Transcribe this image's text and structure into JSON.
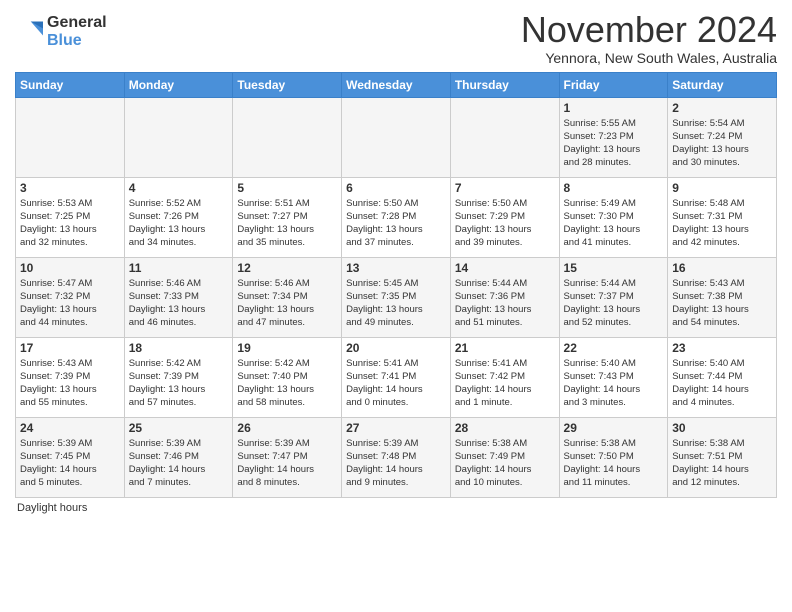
{
  "header": {
    "logo_line1": "General",
    "logo_line2": "Blue",
    "month_title": "November 2024",
    "subtitle": "Yennora, New South Wales, Australia"
  },
  "days_of_week": [
    "Sunday",
    "Monday",
    "Tuesday",
    "Wednesday",
    "Thursday",
    "Friday",
    "Saturday"
  ],
  "weeks": [
    [
      {
        "day": "",
        "info": ""
      },
      {
        "day": "",
        "info": ""
      },
      {
        "day": "",
        "info": ""
      },
      {
        "day": "",
        "info": ""
      },
      {
        "day": "",
        "info": ""
      },
      {
        "day": "1",
        "info": "Sunrise: 5:55 AM\nSunset: 7:23 PM\nDaylight: 13 hours\nand 28 minutes."
      },
      {
        "day": "2",
        "info": "Sunrise: 5:54 AM\nSunset: 7:24 PM\nDaylight: 13 hours\nand 30 minutes."
      }
    ],
    [
      {
        "day": "3",
        "info": "Sunrise: 5:53 AM\nSunset: 7:25 PM\nDaylight: 13 hours\nand 32 minutes."
      },
      {
        "day": "4",
        "info": "Sunrise: 5:52 AM\nSunset: 7:26 PM\nDaylight: 13 hours\nand 34 minutes."
      },
      {
        "day": "5",
        "info": "Sunrise: 5:51 AM\nSunset: 7:27 PM\nDaylight: 13 hours\nand 35 minutes."
      },
      {
        "day": "6",
        "info": "Sunrise: 5:50 AM\nSunset: 7:28 PM\nDaylight: 13 hours\nand 37 minutes."
      },
      {
        "day": "7",
        "info": "Sunrise: 5:50 AM\nSunset: 7:29 PM\nDaylight: 13 hours\nand 39 minutes."
      },
      {
        "day": "8",
        "info": "Sunrise: 5:49 AM\nSunset: 7:30 PM\nDaylight: 13 hours\nand 41 minutes."
      },
      {
        "day": "9",
        "info": "Sunrise: 5:48 AM\nSunset: 7:31 PM\nDaylight: 13 hours\nand 42 minutes."
      }
    ],
    [
      {
        "day": "10",
        "info": "Sunrise: 5:47 AM\nSunset: 7:32 PM\nDaylight: 13 hours\nand 44 minutes."
      },
      {
        "day": "11",
        "info": "Sunrise: 5:46 AM\nSunset: 7:33 PM\nDaylight: 13 hours\nand 46 minutes."
      },
      {
        "day": "12",
        "info": "Sunrise: 5:46 AM\nSunset: 7:34 PM\nDaylight: 13 hours\nand 47 minutes."
      },
      {
        "day": "13",
        "info": "Sunrise: 5:45 AM\nSunset: 7:35 PM\nDaylight: 13 hours\nand 49 minutes."
      },
      {
        "day": "14",
        "info": "Sunrise: 5:44 AM\nSunset: 7:36 PM\nDaylight: 13 hours\nand 51 minutes."
      },
      {
        "day": "15",
        "info": "Sunrise: 5:44 AM\nSunset: 7:37 PM\nDaylight: 13 hours\nand 52 minutes."
      },
      {
        "day": "16",
        "info": "Sunrise: 5:43 AM\nSunset: 7:38 PM\nDaylight: 13 hours\nand 54 minutes."
      }
    ],
    [
      {
        "day": "17",
        "info": "Sunrise: 5:43 AM\nSunset: 7:39 PM\nDaylight: 13 hours\nand 55 minutes."
      },
      {
        "day": "18",
        "info": "Sunrise: 5:42 AM\nSunset: 7:39 PM\nDaylight: 13 hours\nand 57 minutes."
      },
      {
        "day": "19",
        "info": "Sunrise: 5:42 AM\nSunset: 7:40 PM\nDaylight: 13 hours\nand 58 minutes."
      },
      {
        "day": "20",
        "info": "Sunrise: 5:41 AM\nSunset: 7:41 PM\nDaylight: 14 hours\nand 0 minutes."
      },
      {
        "day": "21",
        "info": "Sunrise: 5:41 AM\nSunset: 7:42 PM\nDaylight: 14 hours\nand 1 minute."
      },
      {
        "day": "22",
        "info": "Sunrise: 5:40 AM\nSunset: 7:43 PM\nDaylight: 14 hours\nand 3 minutes."
      },
      {
        "day": "23",
        "info": "Sunrise: 5:40 AM\nSunset: 7:44 PM\nDaylight: 14 hours\nand 4 minutes."
      }
    ],
    [
      {
        "day": "24",
        "info": "Sunrise: 5:39 AM\nSunset: 7:45 PM\nDaylight: 14 hours\nand 5 minutes."
      },
      {
        "day": "25",
        "info": "Sunrise: 5:39 AM\nSunset: 7:46 PM\nDaylight: 14 hours\nand 7 minutes."
      },
      {
        "day": "26",
        "info": "Sunrise: 5:39 AM\nSunset: 7:47 PM\nDaylight: 14 hours\nand 8 minutes."
      },
      {
        "day": "27",
        "info": "Sunrise: 5:39 AM\nSunset: 7:48 PM\nDaylight: 14 hours\nand 9 minutes."
      },
      {
        "day": "28",
        "info": "Sunrise: 5:38 AM\nSunset: 7:49 PM\nDaylight: 14 hours\nand 10 minutes."
      },
      {
        "day": "29",
        "info": "Sunrise: 5:38 AM\nSunset: 7:50 PM\nDaylight: 14 hours\nand 11 minutes."
      },
      {
        "day": "30",
        "info": "Sunrise: 5:38 AM\nSunset: 7:51 PM\nDaylight: 14 hours\nand 12 minutes."
      }
    ]
  ],
  "footer": {
    "label": "Daylight hours"
  }
}
